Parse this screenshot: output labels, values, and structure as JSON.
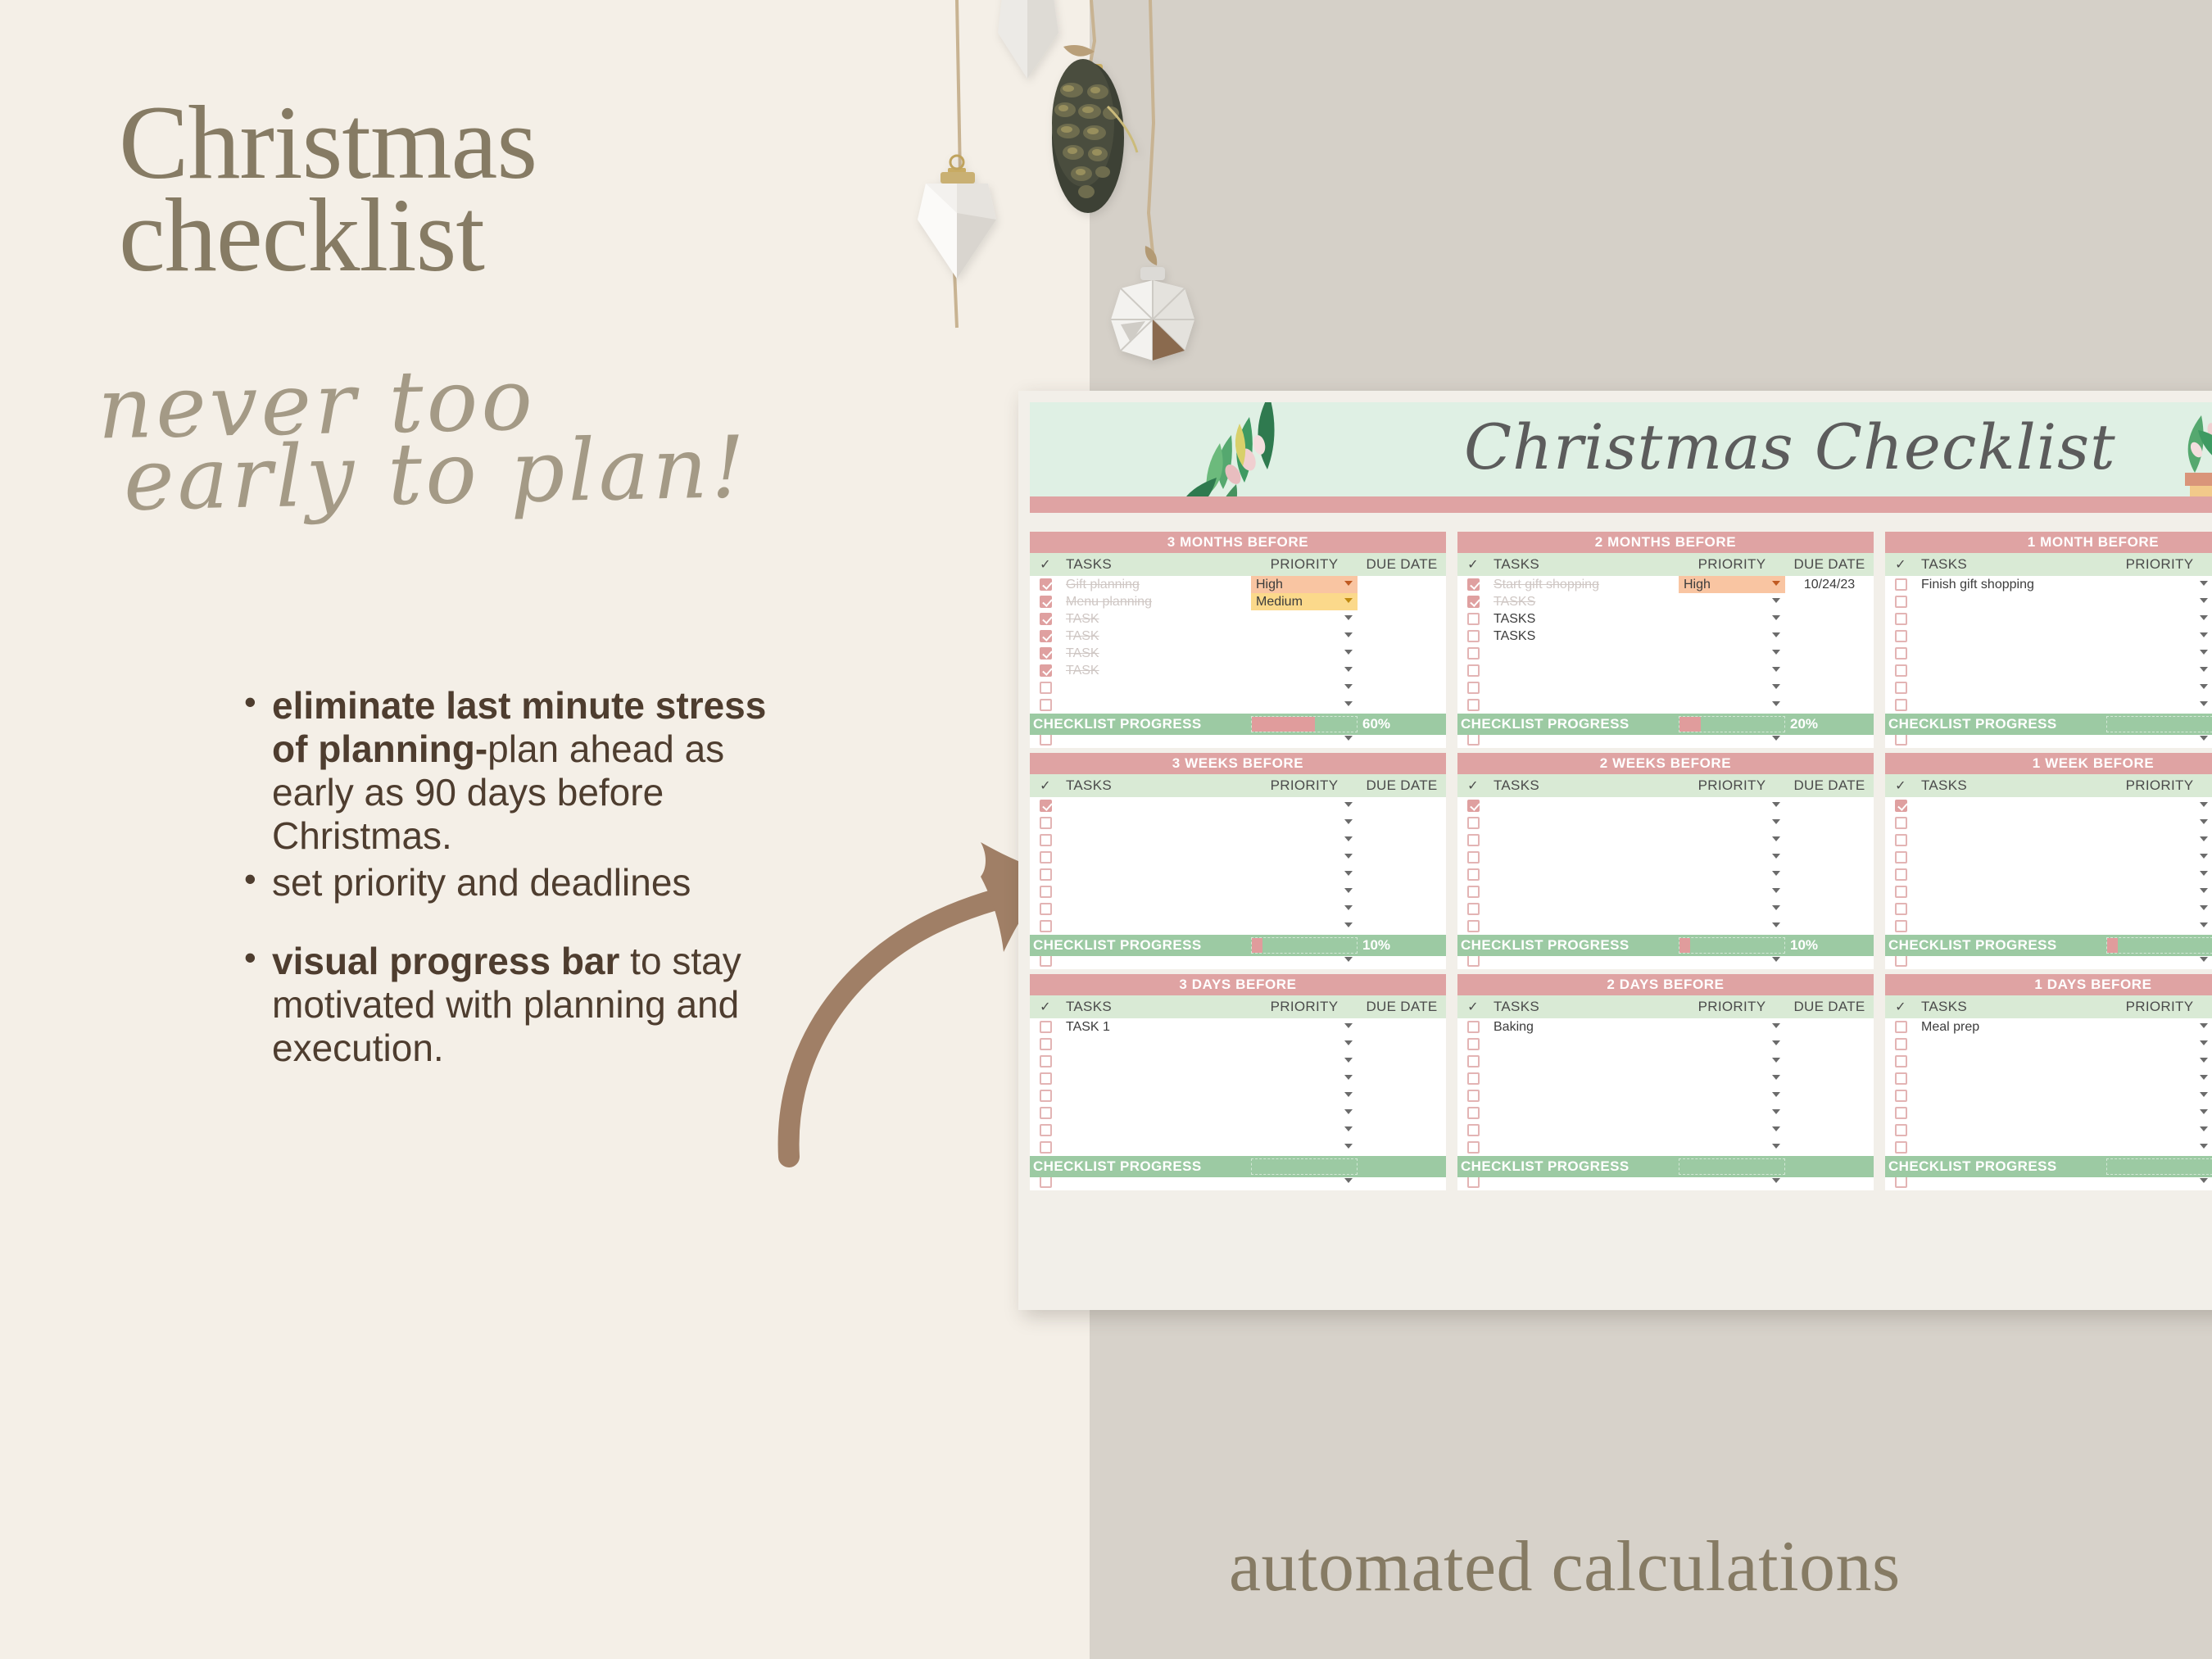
{
  "colors": {
    "cream_bg": "#f4efe7",
    "grey_bg": "#d7d2ca",
    "heading_brown": "#867b64",
    "script_taupe": "#a49a86",
    "body_brown": "#4e3d2f",
    "arrow_brown": "#a07f66",
    "sheet_pink": "#dfa3a3",
    "sheet_green_header": "#d9ead5",
    "sheet_banner_green": "#dff0e4",
    "progress_green": "#9ccaa3",
    "progress_fill_pink": "#e09c9c",
    "priority_high": "#f9c5a2",
    "priority_medium": "#fbd98b"
  },
  "headline": {
    "line1": "Christmas",
    "line2": "checklist",
    "script1": "never too",
    "script2": "early to plan!"
  },
  "bullets": [
    {
      "bold": "eliminate last minute stress of planning-",
      "rest": "plan ahead as early as 90 days before Christmas."
    },
    {
      "bold": "",
      "rest": "set priority and deadlines"
    },
    {
      "bold": "visual progress bar",
      "rest": " to stay motivated with planning and execution."
    }
  ],
  "footer": {
    "text": "automated calculations"
  },
  "sheet": {
    "banner_title": "Christmas Checklist",
    "columns": {
      "check": "✓",
      "tasks": "TASKS",
      "priority": "PRIORITY",
      "due_date": "DUE DATE"
    },
    "progress_label": "CHECKLIST PROGRESS",
    "blocks": [
      {
        "title": "3 MONTHS BEFORE",
        "progress_pct": "60%",
        "progress_value": 60,
        "rows": [
          {
            "checked": true,
            "task": "Gift planning",
            "priority": "High",
            "due": ""
          },
          {
            "checked": true,
            "task": "Menu planning",
            "priority": "Medium",
            "due": ""
          },
          {
            "checked": true,
            "task": "TASK",
            "priority": "",
            "due": ""
          },
          {
            "checked": true,
            "task": "TASK",
            "priority": "",
            "due": ""
          },
          {
            "checked": true,
            "task": "TASK",
            "priority": "",
            "due": ""
          },
          {
            "checked": true,
            "task": "TASK",
            "priority": "",
            "due": ""
          },
          {
            "checked": false,
            "task": "",
            "priority": "",
            "due": ""
          },
          {
            "checked": false,
            "task": "",
            "priority": "",
            "due": ""
          },
          {
            "checked": false,
            "task": "",
            "priority": "",
            "due": ""
          },
          {
            "checked": false,
            "task": "",
            "priority": "",
            "due": ""
          }
        ]
      },
      {
        "title": "2 MONTHS BEFORE",
        "progress_pct": "20%",
        "progress_value": 20,
        "rows": [
          {
            "checked": true,
            "task": "Start gift shopping",
            "priority": "High",
            "due": "10/24/23"
          },
          {
            "checked": true,
            "task": "TASKS",
            "priority": "",
            "due": ""
          },
          {
            "checked": false,
            "task": "TASKS",
            "priority": "",
            "due": ""
          },
          {
            "checked": false,
            "task": "TASKS",
            "priority": "",
            "due": ""
          },
          {
            "checked": false,
            "task": "",
            "priority": "",
            "due": ""
          },
          {
            "checked": false,
            "task": "",
            "priority": "",
            "due": ""
          },
          {
            "checked": false,
            "task": "",
            "priority": "",
            "due": ""
          },
          {
            "checked": false,
            "task": "",
            "priority": "",
            "due": ""
          },
          {
            "checked": false,
            "task": "",
            "priority": "",
            "due": ""
          },
          {
            "checked": false,
            "task": "",
            "priority": "",
            "due": ""
          }
        ]
      },
      {
        "title": "1 MONTH BEFORE",
        "progress_pct": "",
        "progress_value": 0,
        "rows": [
          {
            "checked": false,
            "task": "Finish gift shopping",
            "priority": "",
            "due": ""
          },
          {
            "checked": false,
            "task": "",
            "priority": "",
            "due": ""
          },
          {
            "checked": false,
            "task": "",
            "priority": "",
            "due": ""
          },
          {
            "checked": false,
            "task": "",
            "priority": "",
            "due": ""
          },
          {
            "checked": false,
            "task": "",
            "priority": "",
            "due": ""
          },
          {
            "checked": false,
            "task": "",
            "priority": "",
            "due": ""
          },
          {
            "checked": false,
            "task": "",
            "priority": "",
            "due": ""
          },
          {
            "checked": false,
            "task": "",
            "priority": "",
            "due": ""
          },
          {
            "checked": false,
            "task": "",
            "priority": "",
            "due": ""
          },
          {
            "checked": false,
            "task": "",
            "priority": "",
            "due": ""
          }
        ]
      },
      {
        "title": "3 WEEKS BEFORE",
        "progress_pct": "10%",
        "progress_value": 10,
        "rows": [
          {
            "checked": true,
            "task": "",
            "priority": "",
            "due": ""
          },
          {
            "checked": false,
            "task": "",
            "priority": "",
            "due": ""
          },
          {
            "checked": false,
            "task": "",
            "priority": "",
            "due": ""
          },
          {
            "checked": false,
            "task": "",
            "priority": "",
            "due": ""
          },
          {
            "checked": false,
            "task": "",
            "priority": "",
            "due": ""
          },
          {
            "checked": false,
            "task": "",
            "priority": "",
            "due": ""
          },
          {
            "checked": false,
            "task": "",
            "priority": "",
            "due": ""
          },
          {
            "checked": false,
            "task": "",
            "priority": "",
            "due": ""
          },
          {
            "checked": false,
            "task": "",
            "priority": "",
            "due": ""
          },
          {
            "checked": false,
            "task": "",
            "priority": "",
            "due": ""
          }
        ]
      },
      {
        "title": "2 WEEKS BEFORE",
        "progress_pct": "10%",
        "progress_value": 10,
        "rows": [
          {
            "checked": true,
            "task": "",
            "priority": "",
            "due": ""
          },
          {
            "checked": false,
            "task": "",
            "priority": "",
            "due": ""
          },
          {
            "checked": false,
            "task": "",
            "priority": "",
            "due": ""
          },
          {
            "checked": false,
            "task": "",
            "priority": "",
            "due": ""
          },
          {
            "checked": false,
            "task": "",
            "priority": "",
            "due": ""
          },
          {
            "checked": false,
            "task": "",
            "priority": "",
            "due": ""
          },
          {
            "checked": false,
            "task": "",
            "priority": "",
            "due": ""
          },
          {
            "checked": false,
            "task": "",
            "priority": "",
            "due": ""
          },
          {
            "checked": false,
            "task": "",
            "priority": "",
            "due": ""
          },
          {
            "checked": false,
            "task": "",
            "priority": "",
            "due": ""
          }
        ]
      },
      {
        "title": "1 WEEK BEFORE",
        "progress_pct": "",
        "progress_value": 10,
        "rows": [
          {
            "checked": true,
            "task": "",
            "priority": "",
            "due": ""
          },
          {
            "checked": false,
            "task": "",
            "priority": "",
            "due": ""
          },
          {
            "checked": false,
            "task": "",
            "priority": "",
            "due": ""
          },
          {
            "checked": false,
            "task": "",
            "priority": "",
            "due": ""
          },
          {
            "checked": false,
            "task": "",
            "priority": "",
            "due": ""
          },
          {
            "checked": false,
            "task": "",
            "priority": "",
            "due": ""
          },
          {
            "checked": false,
            "task": "",
            "priority": "",
            "due": ""
          },
          {
            "checked": false,
            "task": "",
            "priority": "",
            "due": ""
          },
          {
            "checked": false,
            "task": "",
            "priority": "",
            "due": ""
          },
          {
            "checked": false,
            "task": "",
            "priority": "",
            "due": ""
          }
        ]
      },
      {
        "title": "3 DAYS BEFORE",
        "progress_pct": "",
        "progress_value": 0,
        "rows": [
          {
            "checked": false,
            "task": "TASK 1",
            "priority": "",
            "due": ""
          },
          {
            "checked": false,
            "task": "",
            "priority": "",
            "due": ""
          },
          {
            "checked": false,
            "task": "",
            "priority": "",
            "due": ""
          },
          {
            "checked": false,
            "task": "",
            "priority": "",
            "due": ""
          },
          {
            "checked": false,
            "task": "",
            "priority": "",
            "due": ""
          },
          {
            "checked": false,
            "task": "",
            "priority": "",
            "due": ""
          },
          {
            "checked": false,
            "task": "",
            "priority": "",
            "due": ""
          },
          {
            "checked": false,
            "task": "",
            "priority": "",
            "due": ""
          },
          {
            "checked": false,
            "task": "",
            "priority": "",
            "due": ""
          },
          {
            "checked": false,
            "task": "",
            "priority": "",
            "due": ""
          }
        ]
      },
      {
        "title": "2 DAYS BEFORE",
        "progress_pct": "",
        "progress_value": 0,
        "rows": [
          {
            "checked": false,
            "task": "Baking",
            "priority": "",
            "due": ""
          },
          {
            "checked": false,
            "task": "",
            "priority": "",
            "due": ""
          },
          {
            "checked": false,
            "task": "",
            "priority": "",
            "due": ""
          },
          {
            "checked": false,
            "task": "",
            "priority": "",
            "due": ""
          },
          {
            "checked": false,
            "task": "",
            "priority": "",
            "due": ""
          },
          {
            "checked": false,
            "task": "",
            "priority": "",
            "due": ""
          },
          {
            "checked": false,
            "task": "",
            "priority": "",
            "due": ""
          },
          {
            "checked": false,
            "task": "",
            "priority": "",
            "due": ""
          },
          {
            "checked": false,
            "task": "",
            "priority": "",
            "due": ""
          },
          {
            "checked": false,
            "task": "",
            "priority": "",
            "due": ""
          }
        ]
      },
      {
        "title": "1 DAYS BEFORE",
        "progress_pct": "",
        "progress_value": 0,
        "rows": [
          {
            "checked": false,
            "task": "Meal prep",
            "priority": "",
            "due": ""
          },
          {
            "checked": false,
            "task": "",
            "priority": "",
            "due": ""
          },
          {
            "checked": false,
            "task": "",
            "priority": "",
            "due": ""
          },
          {
            "checked": false,
            "task": "",
            "priority": "",
            "due": ""
          },
          {
            "checked": false,
            "task": "",
            "priority": "",
            "due": ""
          },
          {
            "checked": false,
            "task": "",
            "priority": "",
            "due": ""
          },
          {
            "checked": false,
            "task": "",
            "priority": "",
            "due": ""
          },
          {
            "checked": false,
            "task": "",
            "priority": "",
            "due": ""
          },
          {
            "checked": false,
            "task": "",
            "priority": "",
            "due": ""
          },
          {
            "checked": false,
            "task": "",
            "priority": "",
            "due": ""
          }
        ]
      }
    ]
  }
}
